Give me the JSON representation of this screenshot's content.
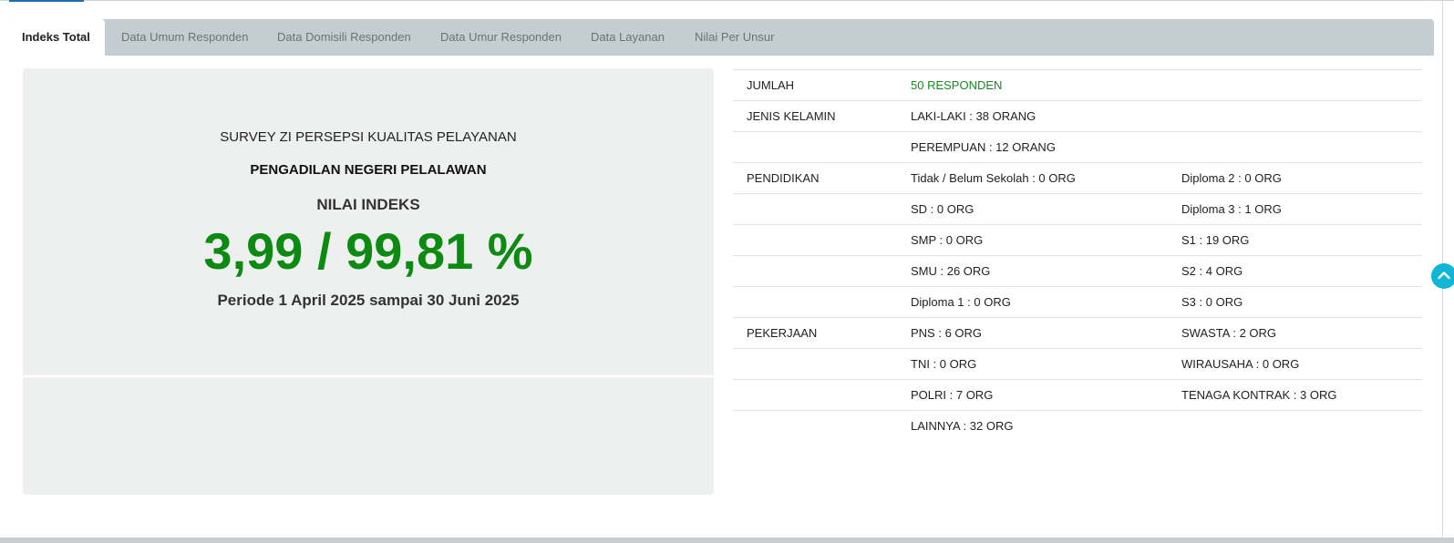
{
  "tabs": [
    {
      "label": "Indeks Total",
      "active": true
    },
    {
      "label": "Data Umum Responden",
      "active": false
    },
    {
      "label": "Data Domisili Responden",
      "active": false
    },
    {
      "label": "Data Umur Responden",
      "active": false
    },
    {
      "label": "Data Layanan",
      "active": false
    },
    {
      "label": "Nilai Per Unsur",
      "active": false
    }
  ],
  "summary": {
    "survey_title": "SURVEY ZI PERSEPSI KUALITAS PELAYANAN",
    "court_name": "PENGADILAN NEGERI PELALAWAN",
    "index_label": "NILAI INDEKS",
    "index_value": "3,99 / 99,81 %",
    "period": "Periode 1 April 2025 sampai 30 Juni 2025"
  },
  "stats": {
    "rows": [
      {
        "label": "JUMLAH",
        "col1": "50 RESPONDEN",
        "col2": ""
      },
      {
        "label": "JENIS KELAMIN",
        "col1": "LAKI-LAKI : 38 ORANG",
        "col2": ""
      },
      {
        "label": "",
        "col1": "PEREMPUAN : 12 ORANG",
        "col2": ""
      },
      {
        "label": "PENDIDIKAN",
        "col1": "Tidak / Belum Sekolah : 0 ORG",
        "col2": "Diploma 2 : 0 ORG"
      },
      {
        "label": "",
        "col1": "SD : 0 ORG",
        "col2": "Diploma 3 : 1 ORG"
      },
      {
        "label": "",
        "col1": "SMP : 0 ORG",
        "col2": "S1 : 19 ORG"
      },
      {
        "label": "",
        "col1": "SMU : 26 ORG",
        "col2": "S2 : 4 ORG"
      },
      {
        "label": "",
        "col1": "Diploma 1 : 0 ORG",
        "col2": "S3 : 0 ORG"
      },
      {
        "label": "PEKERJAAN",
        "col1": "PNS : 6 ORG",
        "col2": "SWASTA : 2 ORG"
      },
      {
        "label": "",
        "col1": "TNI : 0 ORG",
        "col2": "WIRAUSAHA : 0 ORG"
      },
      {
        "label": "",
        "col1": "POLRI : 7 ORG",
        "col2": "TENAGA KONTRAK : 3 ORG"
      },
      {
        "label": "",
        "col1": "LAINNYA : 32 ORG",
        "col2": ""
      }
    ]
  },
  "colors": {
    "accent_green": "#0d8a12",
    "tab_bar": "#c4cdd1",
    "scroll_button": "#11b6d6"
  },
  "icons": {
    "scroll_top": "chevron-up-icon"
  }
}
